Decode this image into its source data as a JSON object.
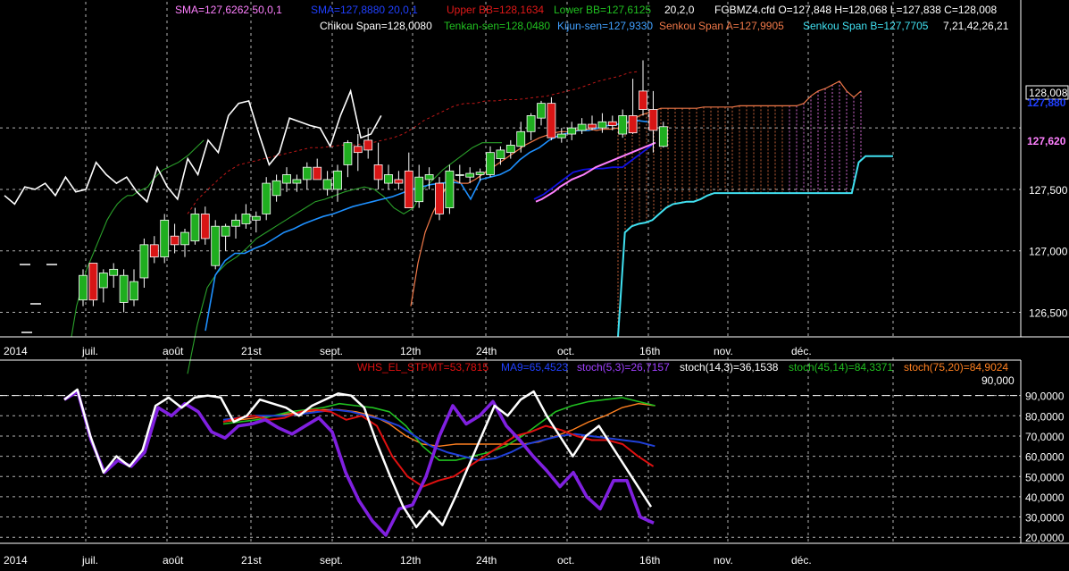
{
  "instrument": "FGBMZ4.cfd",
  "colors": {
    "background": "#000000",
    "grid": "#b4b4b4",
    "axis": "#ffffff",
    "bullish": "#1fae1f",
    "bearish": "#d81515",
    "chikou": "#ffffff",
    "tenkan": "#1e90ff",
    "kijun": "#1010e0",
    "senkou_a": "#f07848",
    "senkou_b": "#40e0f0",
    "sma50": "#ffffff",
    "upper_bb": "#c01818",
    "lower_bb": "#2aa02a",
    "pink": "#ff80ff",
    "stoch_white": "#ffffff",
    "stoch_red": "#e01010",
    "stoch_blue": "#2040d8",
    "stoch_green": "#20c020",
    "stoch_orange": "#ff8020",
    "stoch_purple": "#8020e0"
  },
  "labels": {
    "sma1": "SMA=127,6262  50,0,1",
    "sma2": "SMA=127,8880  20,0,1",
    "upperbb": "Upper BB=128,1634",
    "lowerbb": "Lower BB=127,6125",
    "bbparams": "20,2,0",
    "ohlc": "FGBMZ4.cfd O=127,848 H=128,068 L=127,838 C=128,008",
    "chikou": "Chikou Span=128,0080",
    "tenkan": "Tenkan-sen=128,0480",
    "kijun": "Kijun-sen=127,9330",
    "senkouA": "Senkou Span A=127,9905",
    "senkouB": "Senkou Span B=127,7705",
    "ichiparams": "7,21,42,26,21",
    "whs": "WHS_EL_STPMT=53,7815",
    "ma9": "MA9=65,4523",
    "stoch53": "stoch(5,3)=26,7157",
    "stoch143": "stoch(14,3)=36,1538",
    "stoch4514": "stoch(45,14)=84,3371",
    "stoch7520": "stoch(75,20)=84,9024",
    "level": "90,000"
  },
  "price_tags": [
    {
      "value": "128,008",
      "style": "box"
    },
    {
      "value": "127,880",
      "style": "blue"
    },
    {
      "value": "127,620",
      "style": "pink"
    }
  ],
  "chart_data": [
    {
      "type": "candlestick",
      "panel": "price",
      "ylim": [
        126.3,
        128.75
      ],
      "y_ticks": [
        {
          "value": 128.0,
          "label": ""
        },
        {
          "value": 127.5,
          "label": "127,500"
        },
        {
          "value": 127.0,
          "label": "127,000"
        },
        {
          "value": 126.5,
          "label": "126,500"
        }
      ],
      "x_labels": [
        "2014",
        "juil.",
        "août",
        "21st",
        "sept.",
        "12th",
        "24th",
        "oct.",
        "16th",
        "nov.",
        "déc."
      ],
      "ohlc": [
        [
          126.6,
          126.85,
          126.55,
          126.8
        ],
        [
          126.9,
          126.9,
          126.55,
          126.6
        ],
        [
          126.7,
          126.85,
          126.58,
          126.82
        ],
        [
          126.8,
          126.9,
          126.7,
          126.85
        ],
        [
          126.58,
          126.85,
          126.5,
          126.8
        ],
        [
          126.6,
          126.85,
          126.55,
          126.75
        ],
        [
          126.78,
          127.1,
          126.7,
          127.05
        ],
        [
          127.05,
          127.12,
          126.9,
          126.95
        ],
        [
          126.95,
          127.3,
          126.9,
          127.25
        ],
        [
          127.12,
          127.22,
          126.98,
          127.05
        ],
        [
          127.05,
          127.18,
          126.95,
          127.15
        ],
        [
          127.08,
          127.35,
          127.05,
          127.3
        ],
        [
          127.3,
          127.36,
          127.05,
          127.1
        ],
        [
          126.88,
          127.25,
          126.85,
          127.2
        ],
        [
          127.12,
          127.22,
          127.0,
          127.2
        ],
        [
          127.2,
          127.3,
          127.1,
          127.25
        ],
        [
          127.22,
          127.38,
          127.18,
          127.3
        ],
        [
          127.25,
          127.32,
          127.15,
          127.28
        ],
        [
          127.3,
          127.6,
          127.25,
          127.55
        ],
        [
          127.45,
          127.62,
          127.4,
          127.57
        ],
        [
          127.55,
          127.68,
          127.48,
          127.62
        ],
        [
          127.55,
          127.62,
          127.48,
          127.58
        ],
        [
          127.58,
          127.72,
          127.5,
          127.68
        ],
        [
          127.68,
          127.75,
          127.6,
          127.58
        ],
        [
          127.5,
          127.65,
          127.45,
          127.58
        ],
        [
          127.5,
          127.7,
          127.4,
          127.65
        ],
        [
          127.7,
          127.9,
          127.6,
          127.88
        ],
        [
          127.85,
          127.95,
          127.65,
          127.8
        ],
        [
          127.9,
          128.0,
          127.75,
          127.82
        ],
        [
          127.7,
          127.88,
          127.5,
          127.58
        ],
        [
          127.55,
          127.7,
          127.5,
          127.62
        ],
        [
          127.58,
          127.65,
          127.5,
          127.55
        ],
        [
          127.65,
          127.8,
          127.5,
          127.35
        ],
        [
          127.4,
          127.7,
          127.35,
          127.6
        ],
        [
          127.58,
          127.68,
          127.5,
          127.62
        ],
        [
          127.55,
          127.6,
          127.25,
          127.3
        ],
        [
          127.35,
          127.7,
          127.3,
          127.65
        ],
        [
          127.62,
          127.7,
          127.55,
          127.62
        ],
        [
          127.6,
          127.68,
          127.55,
          127.63
        ],
        [
          127.62,
          127.67,
          127.57,
          127.64
        ],
        [
          127.62,
          127.85,
          127.6,
          127.8
        ],
        [
          127.75,
          127.85,
          127.7,
          127.82
        ],
        [
          127.8,
          127.9,
          127.75,
          127.86
        ],
        [
          127.85,
          128.05,
          127.8,
          127.97
        ],
        [
          127.97,
          128.12,
          127.9,
          128.1
        ],
        [
          128.08,
          128.22,
          128.02,
          128.2
        ],
        [
          128.2,
          128.25,
          127.9,
          127.92
        ],
        [
          127.92,
          128.0,
          127.88,
          127.95
        ],
        [
          127.95,
          128.05,
          127.9,
          128.0
        ],
        [
          127.98,
          128.08,
          127.95,
          128.03
        ],
        [
          128.03,
          128.1,
          127.98,
          128.0
        ],
        [
          128.0,
          128.12,
          127.96,
          128.05
        ],
        [
          128.05,
          128.1,
          127.98,
          128.02
        ],
        [
          127.95,
          128.15,
          127.92,
          128.1
        ],
        [
          128.1,
          128.4,
          127.95,
          127.96
        ],
        [
          128.3,
          128.55,
          128.1,
          128.15
        ],
        [
          128.15,
          128.3,
          127.8,
          127.98
        ],
        [
          127.85,
          128.05,
          127.84,
          128.01
        ]
      ],
      "chikou": [
        127.45,
        127.38,
        127.52,
        127.5,
        127.55,
        127.45,
        127.6,
        127.48,
        127.5,
        127.72,
        127.62,
        127.55,
        127.6,
        127.48,
        127.4,
        127.68,
        127.52,
        127.42,
        127.75,
        127.62,
        127.9,
        127.8,
        128.1,
        128.2,
        128.22,
        127.95,
        127.7,
        127.8,
        128.08,
        128.05,
        128.02,
        128.0,
        127.85,
        128.1,
        128.3,
        127.92,
        127.95,
        128.1
      ],
      "tenkan": [
        126.35,
        126.8,
        126.92,
        126.98,
        126.98,
        127.02,
        127.05,
        127.1,
        127.15,
        127.18,
        127.22,
        127.25,
        127.28,
        127.3,
        127.33,
        127.36,
        127.38,
        127.4,
        127.42,
        127.44,
        127.47,
        127.5,
        127.52,
        127.54,
        127.55,
        127.56,
        127.55,
        127.42,
        127.58,
        127.6,
        127.62,
        127.66,
        127.74,
        127.8,
        127.84,
        127.9,
        127.94,
        127.96,
        127.98,
        127.98,
        128.0,
        128.02,
        128.03,
        128.05,
        128.06,
        128.05
      ],
      "kijun": [
        127.42,
        127.46,
        127.52,
        127.58,
        127.64,
        127.66,
        127.67,
        127.67,
        127.68,
        127.68,
        127.74,
        127.8,
        127.86
      ],
      "senkou_a": [
        126.55,
        126.9,
        127.15,
        127.3,
        127.42,
        127.52,
        127.58,
        127.55,
        127.55,
        127.58,
        127.62,
        127.66,
        127.7,
        127.74,
        127.78,
        127.82,
        127.86,
        127.89,
        127.92,
        127.94,
        127.96,
        127.97,
        127.97,
        127.98,
        127.99,
        127.99,
        127.98,
        127.99,
        127.99,
        128.0,
        128.03,
        128.06,
        128.1,
        128.12,
        128.14,
        128.16,
        128.16,
        128.16,
        128.16,
        128.16,
        128.16,
        128.17,
        128.17,
        128.17,
        128.17,
        128.17,
        128.18,
        128.18,
        128.18,
        128.18,
        128.18,
        128.18,
        128.18,
        128.18,
        128.18,
        128.2,
        128.26,
        128.3,
        128.32,
        128.35,
        128.38,
        128.3,
        128.25,
        128.3
      ],
      "senkou_b": [
        126.3,
        127.15,
        127.2,
        127.22,
        127.23,
        127.25,
        127.3,
        127.35,
        127.38,
        127.39,
        127.4,
        127.4,
        127.42,
        127.45,
        127.47,
        127.47,
        127.47,
        127.47,
        127.47,
        127.47,
        127.47,
        127.47,
        127.47,
        127.47,
        127.47,
        127.47,
        127.47,
        127.47,
        127.47,
        127.47,
        127.47,
        127.47,
        127.47,
        127.47,
        127.47,
        127.72,
        127.77,
        127.77,
        127.77,
        127.77,
        127.77
      ],
      "sma50_pink": [
        127.4,
        127.42,
        127.45,
        127.48,
        127.52,
        127.55,
        127.58,
        127.6,
        127.62,
        127.65,
        127.68,
        127.7,
        127.72,
        127.74,
        127.76,
        127.78,
        127.8,
        127.82,
        127.84,
        127.86,
        127.88
      ],
      "upper_bb": [
        127.3,
        127.42,
        127.5,
        127.58,
        127.65,
        127.7,
        127.72,
        127.74,
        127.76,
        127.78,
        127.8,
        127.82,
        127.84,
        127.84,
        127.85,
        127.86,
        127.86,
        127.87,
        127.88,
        127.9,
        127.92,
        127.95,
        128.0,
        128.06,
        128.1,
        128.14,
        128.18,
        128.2,
        128.2,
        128.22,
        128.22,
        128.23,
        128.23,
        128.24,
        128.25,
        128.26,
        128.28,
        128.3,
        128.32,
        128.35,
        128.38,
        128.4,
        128.42,
        128.45,
        128.46
      ],
      "lower_bb": [
        126.0,
        126.4,
        126.7,
        126.82,
        126.9,
        126.95,
        127.02,
        127.1,
        127.15,
        127.2,
        127.25,
        127.3,
        127.35,
        127.4,
        127.42,
        127.45,
        127.48,
        127.5,
        127.52,
        127.5,
        127.44,
        127.35,
        127.3,
        127.35,
        127.5,
        127.58,
        127.66,
        127.72,
        127.78,
        127.84,
        127.88,
        127.88,
        127.88
      ],
      "lower_bb_tail": [
        126.3,
        126.55,
        126.7,
        126.85,
        126.95,
        127.05,
        127.15,
        127.25,
        127.32,
        127.38,
        127.42,
        127.45,
        127.45,
        127.48,
        127.5,
        127.52,
        127.58,
        127.62,
        127.66,
        127.68,
        127.7,
        127.72,
        127.75,
        127.78,
        127.82,
        127.86,
        127.9
      ]
    },
    {
      "type": "line",
      "panel": "oscillator",
      "ylim": [
        17,
        100
      ],
      "y_ticks": [
        {
          "value": 90,
          "label": "90,0000"
        },
        {
          "value": 80,
          "label": "80,0000"
        },
        {
          "value": 70,
          "label": "70,0000"
        },
        {
          "value": 60,
          "label": "60,0000"
        },
        {
          "value": 50,
          "label": "50,0000"
        },
        {
          "value": 40,
          "label": "40,0000"
        },
        {
          "value": 30,
          "label": "30,0000"
        },
        {
          "value": 20,
          "label": "20,0000"
        }
      ],
      "reference_line": 90,
      "x_labels": [
        "2014",
        "juil.",
        "août",
        "21st",
        "sept.",
        "12th",
        "24th",
        "oct.",
        "16th",
        "nov.",
        "déc."
      ],
      "series": [
        {
          "name": "stoch(14,3)",
          "color": "stoch_white",
          "values": [
            88,
            93,
            70,
            52,
            60,
            55,
            63,
            85,
            89,
            84,
            89,
            90,
            89,
            77,
            80,
            88,
            86,
            84,
            80,
            85,
            88,
            91,
            90,
            84,
            66,
            50,
            35,
            25,
            33,
            26,
            40,
            55,
            70,
            85,
            80,
            88,
            92,
            80,
            70,
            60,
            70,
            75,
            65,
            55,
            45,
            35
          ]
        },
        {
          "name": "WHS_EL_STPMT",
          "color": "stoch_purple",
          "values": [
            88,
            92,
            68,
            52,
            58,
            55,
            62,
            84,
            80,
            86,
            82,
            72,
            69,
            75,
            76,
            78,
            74,
            71,
            75,
            79,
            72,
            52,
            38,
            28,
            21,
            34,
            36,
            50,
            70,
            85,
            76,
            80,
            87,
            75,
            68,
            60,
            53,
            45,
            52,
            40,
            34,
            48,
            48,
            30,
            27
          ]
        },
        {
          "name": "stoch(5,3)",
          "color": "stoch_red",
          "values": [
            77,
            79,
            80,
            78,
            79,
            82,
            83,
            82,
            78,
            80,
            75,
            60,
            50,
            45,
            48,
            50,
            55,
            60,
            65,
            70,
            72,
            75,
            73,
            70,
            68,
            68,
            66,
            60,
            55
          ]
        },
        {
          "name": "MA9",
          "color": "stoch_blue",
          "values": [
            78,
            79,
            80,
            80,
            80,
            81,
            82,
            83,
            82,
            80,
            78,
            75,
            70,
            65,
            62,
            60,
            58,
            59,
            62,
            66,
            68,
            70,
            71,
            70,
            69,
            68,
            67,
            65
          ]
        },
        {
          "name": "stoch(45,14)",
          "color": "stoch_green",
          "values": [
            76,
            77,
            78,
            80,
            82,
            83,
            84,
            86,
            85,
            84,
            82,
            75,
            65,
            58,
            58,
            60,
            62,
            65,
            70,
            76,
            82,
            85,
            87,
            88,
            89,
            87,
            85
          ]
        },
        {
          "name": "stoch(75,20)",
          "color": "stoch_orange",
          "values": [
            77,
            78,
            79,
            80,
            81,
            82,
            83,
            83,
            82,
            80,
            76,
            70,
            66,
            65,
            66,
            66,
            66,
            66,
            66,
            67,
            70,
            73,
            77,
            80,
            84,
            86,
            85
          ]
        }
      ]
    }
  ]
}
